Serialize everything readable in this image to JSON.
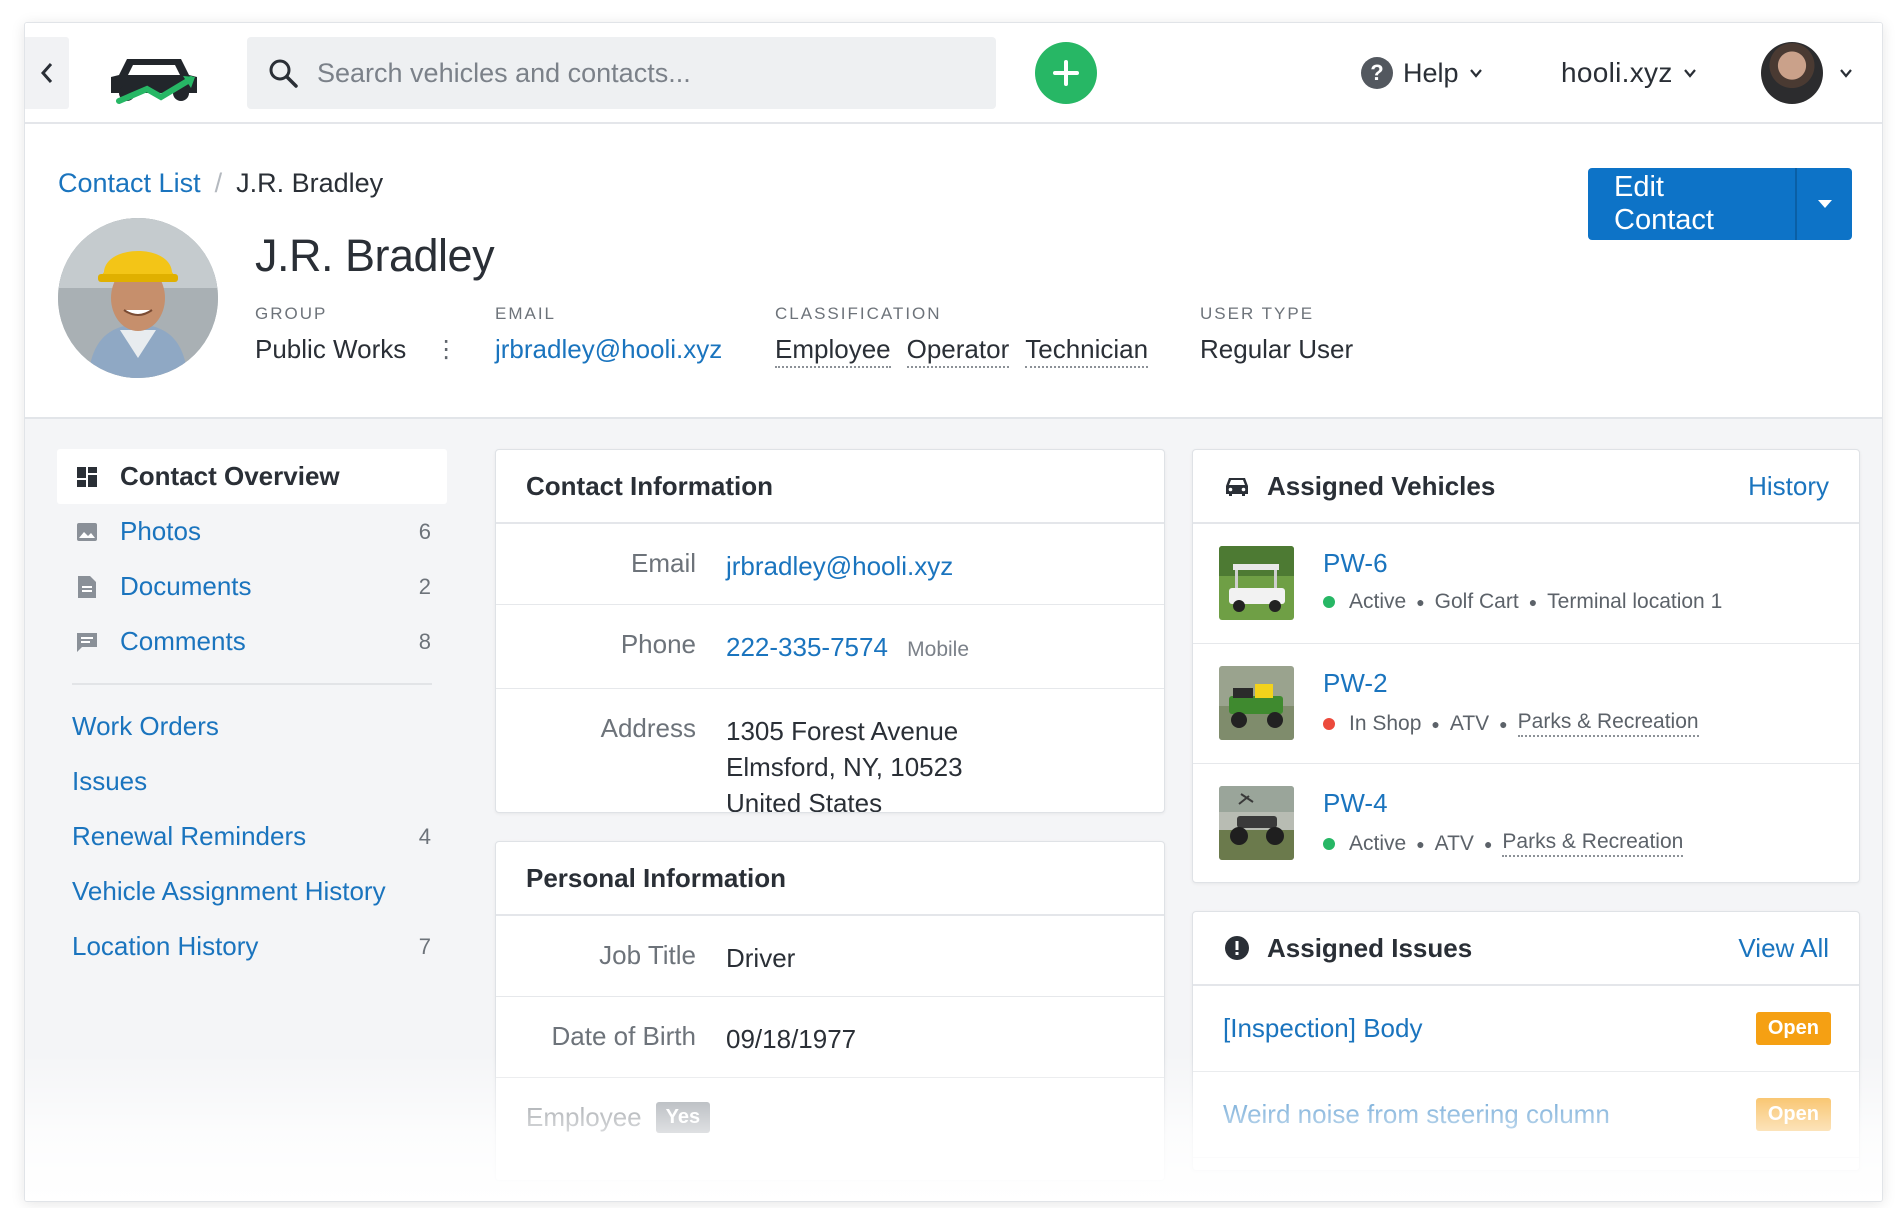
{
  "topnav": {
    "search_placeholder": "Search vehicles and contacts...",
    "help_label": "Help",
    "org_name": "hooli.xyz",
    "add_color": "#27b765"
  },
  "breadcrumb": {
    "parent": "Contact List",
    "separator": "/",
    "current": "J.R. Bradley"
  },
  "header": {
    "edit_label": "Edit Contact",
    "name": "J.R. Bradley",
    "group": {
      "label": "GROUP",
      "value": "Public Works"
    },
    "email": {
      "label": "EMAIL",
      "value": "jrbradley@hooli.xyz"
    },
    "classification": {
      "label": "CLASSIFICATION",
      "values": [
        "Employee",
        "Operator",
        "Technician"
      ]
    },
    "user_type": {
      "label": "USER TYPE",
      "value": "Regular User"
    }
  },
  "sidenav": {
    "items": [
      {
        "label": "Contact Overview",
        "icon": "dashboard-icon",
        "count": ""
      },
      {
        "label": "Photos",
        "icon": "image-icon",
        "count": "6"
      },
      {
        "label": "Documents",
        "icon": "document-icon",
        "count": "2"
      },
      {
        "label": "Comments",
        "icon": "comment-icon",
        "count": "8"
      }
    ],
    "links": [
      {
        "label": "Work Orders",
        "count": ""
      },
      {
        "label": "Issues",
        "count": ""
      },
      {
        "label": "Renewal Reminders",
        "count": "4"
      },
      {
        "label": "Vehicle Assignment History",
        "count": ""
      },
      {
        "label": "Location History",
        "count": "7"
      }
    ]
  },
  "contact_info": {
    "title": "Contact Information",
    "email_label": "Email",
    "email": "jrbradley@hooli.xyz",
    "phone_label": "Phone",
    "phone": "222-335-7574",
    "phone_type": "Mobile",
    "address_label": "Address",
    "address_line1": "1305 Forest Avenue",
    "address_line2": "Elmsford, NY, 10523",
    "address_line3": "United States"
  },
  "personal_info": {
    "title": "Personal Information",
    "job_title_label": "Job Title",
    "job_title": "Driver",
    "dob_label": "Date of Birth",
    "dob": "09/18/1977",
    "employee_label": "Employee",
    "employee_value": "Yes"
  },
  "assigned_vehicles": {
    "title": "Assigned Vehicles",
    "action": "History",
    "items": [
      {
        "name": "PW-6",
        "status": "Active",
        "status_color": "#27b765",
        "type": "Golf Cart",
        "location": "Terminal location 1"
      },
      {
        "name": "PW-2",
        "status": "In Shop",
        "status_color": "#ec4a3c",
        "type": "ATV",
        "location": "Parks & Recreation"
      },
      {
        "name": "PW-4",
        "status": "Active",
        "status_color": "#27b765",
        "type": "ATV",
        "location": "Parks & Recreation"
      }
    ]
  },
  "assigned_issues": {
    "title": "Assigned Issues",
    "action": "View All",
    "items": [
      {
        "title": "[Inspection] Body",
        "status": "Open"
      },
      {
        "title": "Weird noise from steering column",
        "status": "Open"
      }
    ]
  }
}
